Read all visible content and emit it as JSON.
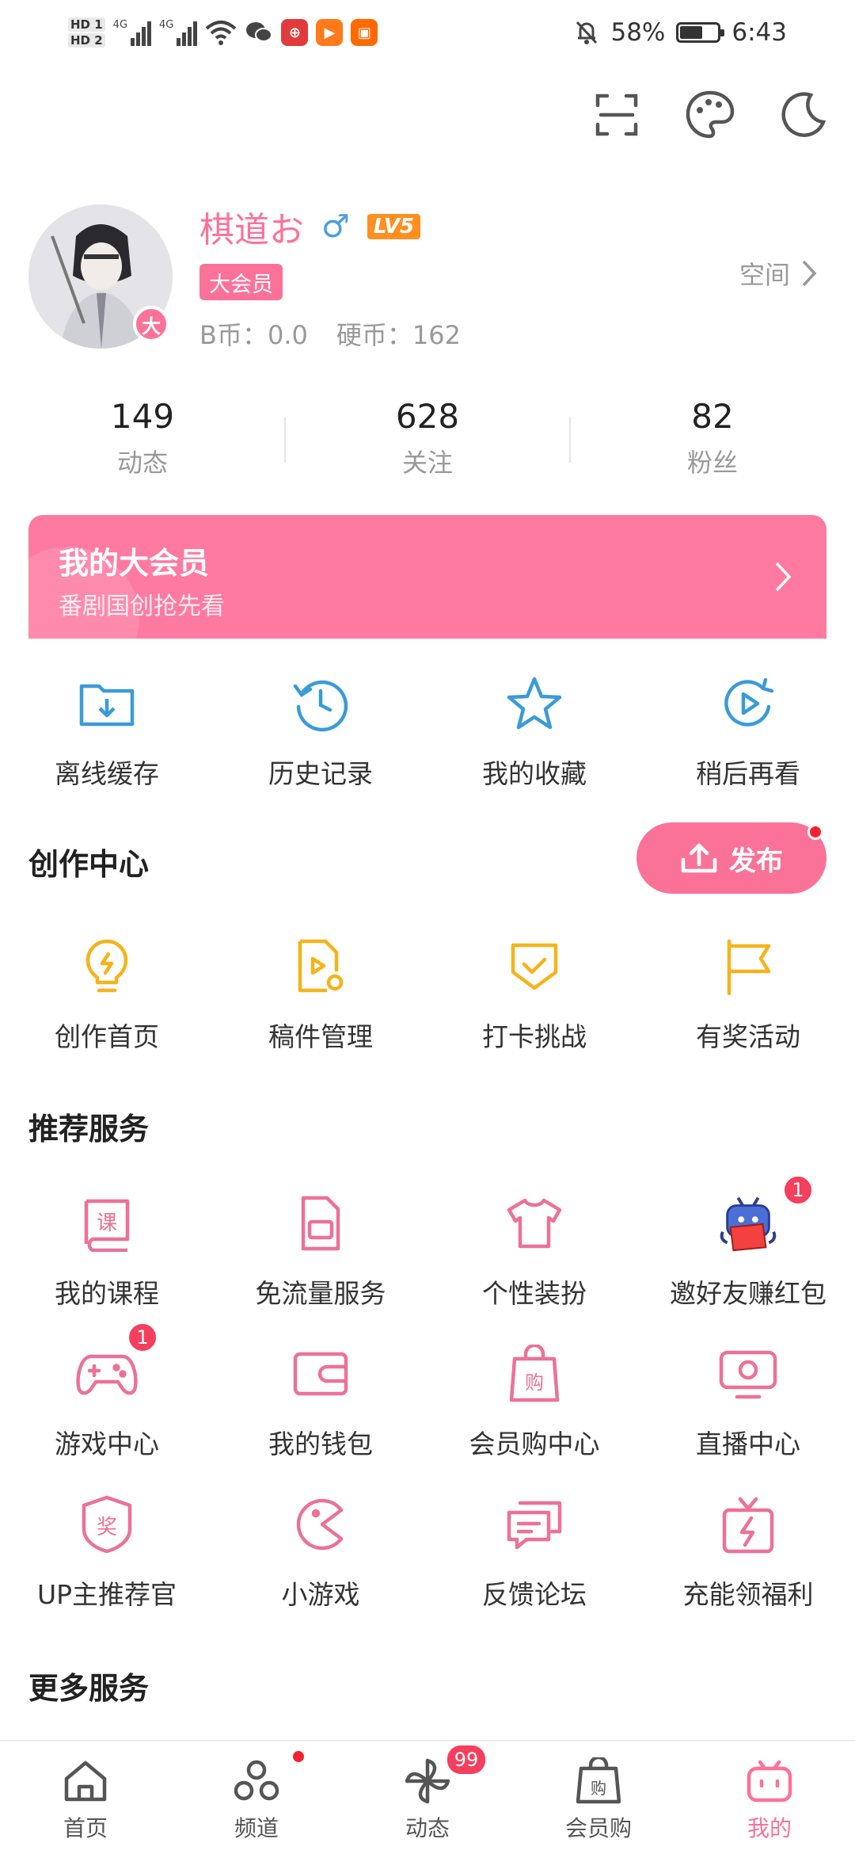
{
  "status_bar": {
    "sim1": "HD 1",
    "sim2": "HD 2",
    "net1": "4G",
    "net2": "4G",
    "battery": "58%",
    "battery_level": 0.58,
    "time": "6:43"
  },
  "top_icons": [
    "scan-icon",
    "palette-icon",
    "moon-icon"
  ],
  "profile": {
    "username": "棋道お",
    "gender": "♂",
    "level": "LV5",
    "vip_badge": "大会员",
    "avatar_badge": "大",
    "b_coin": "B币：0.0",
    "hard_coin": "硬币：162",
    "space_link": "空间"
  },
  "stats": [
    {
      "value": "149",
      "label": "动态"
    },
    {
      "value": "628",
      "label": "关注"
    },
    {
      "value": "82",
      "label": "粉丝"
    }
  ],
  "vip_banner": {
    "title": "我的大会员",
    "subtitle": "番剧国创抢先看"
  },
  "quick_actions": [
    {
      "label": "离线缓存",
      "icon": "download-folder-icon"
    },
    {
      "label": "历史记录",
      "icon": "history-icon"
    },
    {
      "label": "我的收藏",
      "icon": "star-icon"
    },
    {
      "label": "稍后再看",
      "icon": "watch-later-icon"
    }
  ],
  "creation": {
    "title": "创作中心",
    "publish_label": "发布",
    "items": [
      {
        "label": "创作首页",
        "icon": "lightbulb-icon"
      },
      {
        "label": "稿件管理",
        "icon": "manuscript-icon"
      },
      {
        "label": "打卡挑战",
        "icon": "checkin-icon"
      },
      {
        "label": "有奖活动",
        "icon": "flag-icon"
      }
    ]
  },
  "recommended": {
    "title": "推荐服务",
    "rows": [
      [
        {
          "label": "我的课程",
          "icon": "course-icon",
          "badge": ""
        },
        {
          "label": "免流量服务",
          "icon": "sim-card-icon",
          "badge": ""
        },
        {
          "label": "个性装扮",
          "icon": "tshirt-icon",
          "badge": ""
        },
        {
          "label": "邀好友赚红包",
          "icon": "tv-mascot-icon",
          "badge": "1"
        }
      ],
      [
        {
          "label": "游戏中心",
          "icon": "gamepad-icon",
          "badge": "1"
        },
        {
          "label": "我的钱包",
          "icon": "wallet-icon",
          "badge": ""
        },
        {
          "label": "会员购中心",
          "icon": "shopping-bag-icon",
          "badge": ""
        },
        {
          "label": "直播中心",
          "icon": "live-tv-icon",
          "badge": ""
        }
      ],
      [
        {
          "label": "UP主推荐官",
          "icon": "award-icon",
          "badge": ""
        },
        {
          "label": "小游戏",
          "icon": "pacman-icon",
          "badge": ""
        },
        {
          "label": "反馈论坛",
          "icon": "chat-icon",
          "badge": ""
        },
        {
          "label": "充能领福利",
          "icon": "gift-energy-icon",
          "badge": ""
        }
      ]
    ]
  },
  "more": {
    "title": "更多服务"
  },
  "tabbar": {
    "items": [
      {
        "label": "首页",
        "icon": "home-icon"
      },
      {
        "label": "频道",
        "icon": "channel-icon"
      },
      {
        "label": "动态",
        "icon": "pinwheel-icon",
        "badge": "99"
      },
      {
        "label": "会员购",
        "icon": "shop-bag-icon"
      },
      {
        "label": "我的",
        "icon": "tv-icon"
      }
    ]
  },
  "colors": {
    "brand_pink": "#fb7299",
    "blue_icon": "#3a9bd9",
    "gold_icon": "#f5b31b",
    "badge_red": "#f43f5e"
  }
}
